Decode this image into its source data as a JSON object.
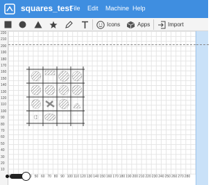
{
  "app": {
    "title": "squares_test"
  },
  "menu": {
    "file": "File",
    "edit": "Edit",
    "machine": "Machine",
    "help": "Help"
  },
  "toolbar": {
    "icons_label": "Icons",
    "apps_label": "Apps",
    "import_label": "Import"
  },
  "rulers": {
    "y": [
      "220",
      "210",
      "200",
      "190",
      "180",
      "170",
      "160",
      "150",
      "140",
      "130",
      "120",
      "110",
      "100",
      "90",
      "80",
      "70",
      "60",
      "50",
      "40",
      "30",
      "20",
      "10"
    ],
    "x": [
      "10",
      "20",
      "30",
      "40",
      "50",
      "60",
      "70",
      "80",
      "90",
      "100",
      "110",
      "120",
      "130",
      "140",
      "150",
      "160",
      "170",
      "180",
      "190",
      "200",
      "210",
      "220",
      "230",
      "240",
      "250",
      "260",
      "270",
      "280"
    ]
  },
  "colors": {
    "menubar": "#3f8ee0",
    "panel": "#c9e1f8",
    "toolbar": "#f4f4f4"
  },
  "icons": [
    "app-logo-icon",
    "square-icon",
    "circle-icon",
    "triangle-icon",
    "star-icon",
    "pen-icon",
    "text-icon",
    "smiley-icon",
    "cube-icon",
    "import-icon"
  ]
}
